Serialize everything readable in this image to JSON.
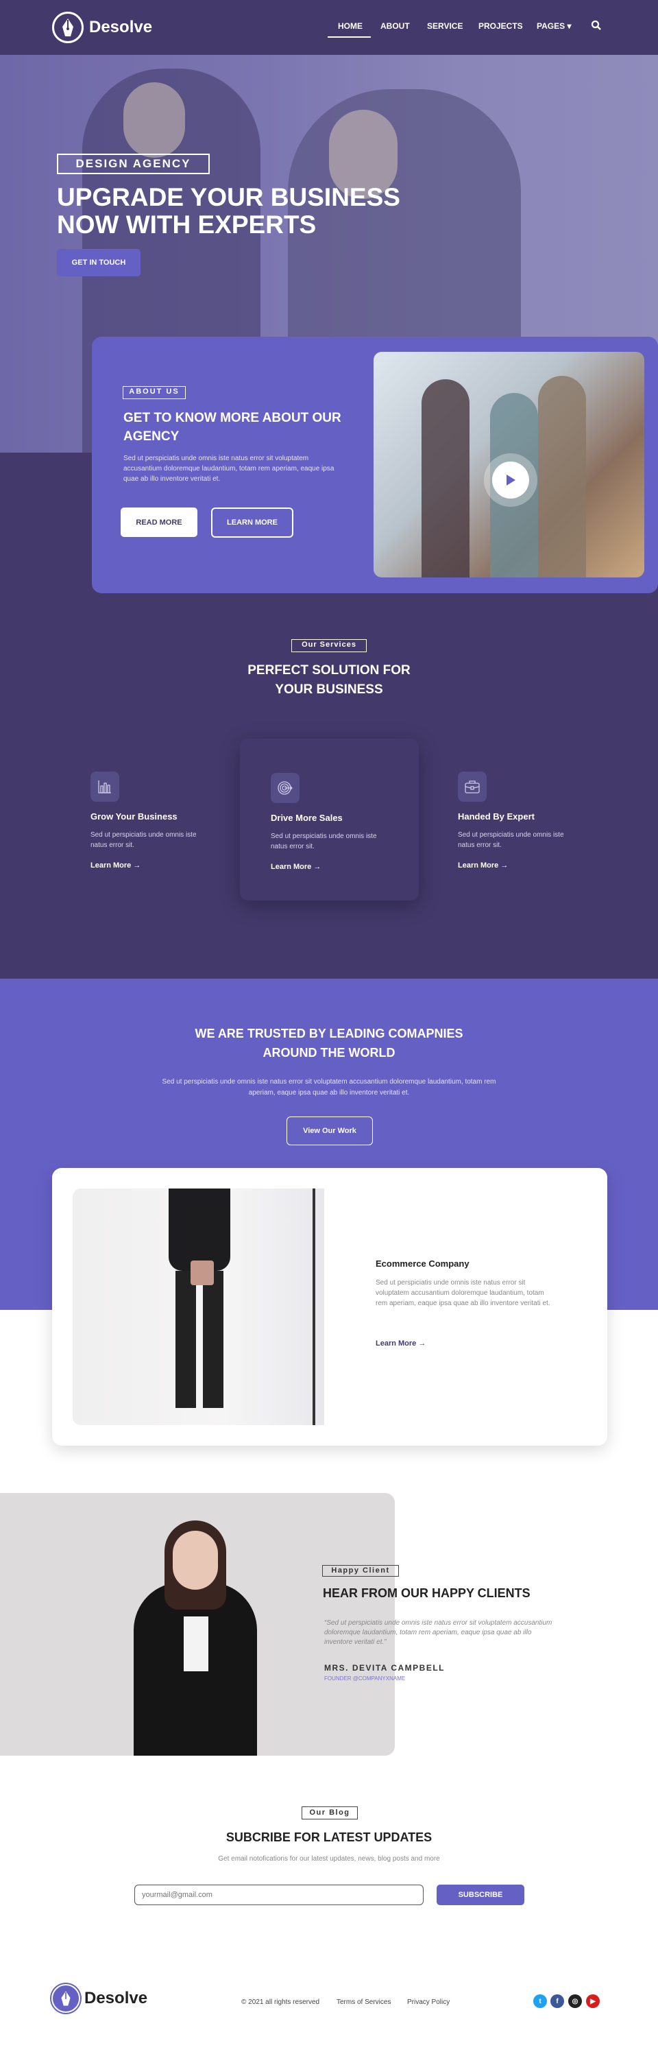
{
  "header": {
    "brand": "Desolve",
    "nav": [
      {
        "label": "HOME",
        "active": true
      },
      {
        "label": "ABOUT"
      },
      {
        "label": "SERVICE"
      },
      {
        "label": "PROJECTS"
      },
      {
        "label": "PAGES ▾"
      }
    ],
    "search_icon": "search-icon"
  },
  "hero": {
    "badge": "DESIGN AGENCY",
    "title_line1": "UPGRADE YOUR BUSINESS",
    "title_line2": "NOW WITH EXPERTS",
    "cta": "GET IN TOUCH"
  },
  "about": {
    "badge": "ABOUT US",
    "title": "GET TO KNOW MORE ABOUT OUR AGENCY",
    "text": "Sed ut perspiciatis unde omnis iste natus error sit voluptatem accusantium doloremque laudantium, totam rem aperiam, eaque ipsa quae ab illo inventore veritati et.",
    "read_more": "READ MORE",
    "learn_more": "LEARN MORE"
  },
  "services": {
    "badge": "Our Services",
    "title_line1": "PERFECT SOLUTION FOR",
    "title_line2": "YOUR BUSINESS",
    "items": [
      {
        "icon": "bar-chart-icon",
        "title": "Grow Your Business",
        "desc": "Sed ut perspiciatis unde omnis iste natus error sit.",
        "link": "Learn More →"
      },
      {
        "icon": "target-icon",
        "title": "Drive More Sales",
        "desc": "Sed ut perspiciatis unde omnis iste natus error sit.",
        "link": "Learn More →"
      },
      {
        "icon": "briefcase-icon",
        "title": "Handed By Expert",
        "desc": "Sed ut perspiciatis unde omnis iste natus error sit.",
        "link": "Learn More →"
      }
    ]
  },
  "trusted": {
    "title_line1": "WE ARE TRUSTED BY LEADING COMAPNIES",
    "title_line2": "AROUND THE WORLD",
    "text": "Sed ut perspiciatis unde omnis iste natus error sit voluptatem accusantium doloremque laudantium, totam rem aperiam, eaque ipsa quae ab illo inventore veritati et.",
    "button": "View Our Work"
  },
  "project": {
    "title": "Ecommerce Company",
    "text": "Sed ut perspiciatis unde omnis iste natus error sit voluptatem accusantium doloremque laudantium, totam rem aperiam, eaque ipsa quae ab illo inventore veritati et.",
    "link": "Learn More →"
  },
  "testimonial": {
    "badge": "Happy Client",
    "title": "HEAR FROM OUR HAPPY CLIENTS",
    "quote": "“Sed ut perspiciatis unde omnis iste natus error sit voluptatem accusantium doloremque laudantium, totam rem aperiam, eaque ipsa quae ab illo inventore veritati et.”",
    "name": "MRS. DEVITA CAMPBELL",
    "role": "FOUNDER @COMPANYXNAME"
  },
  "blog": {
    "badge": "Our Blog",
    "title": "SUBCRIBE FOR LATEST UPDATES",
    "subtitle": "Get email notofications for our latest updates, news, blog posts and more",
    "email_placeholder": "yourmail@gmail.com",
    "button": "SUBSCRIBE"
  },
  "footer": {
    "brand": "Desolve",
    "copyright": "© 2021 all rights reserved",
    "terms": "Terms of Services",
    "privacy": "Privacy Policy",
    "socials": [
      {
        "icon": "twitter-icon",
        "color": "#1da1f2"
      },
      {
        "icon": "facebook-icon",
        "color": "#3b5998"
      },
      {
        "icon": "instagram-icon",
        "color": "#222222"
      },
      {
        "icon": "youtube-icon",
        "color": "#d91c1c"
      }
    ]
  },
  "colors": {
    "primary": "#6560c4",
    "dark": "#433a6b"
  }
}
